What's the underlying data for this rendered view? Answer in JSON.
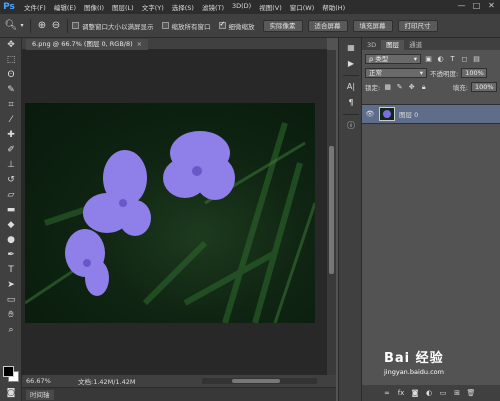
{
  "app": {
    "logo": "Ps"
  },
  "menu": [
    "文件(F)",
    "编辑(E)",
    "图像(I)",
    "图层(L)",
    "文字(Y)",
    "选择(S)",
    "滤镜(T)",
    "3D(D)",
    "视图(V)",
    "窗口(W)",
    "帮助(H)"
  ],
  "window_controls": [
    "—",
    "□",
    "✕"
  ],
  "options_bar": {
    "tool_icon": "zoom-icon",
    "checkboxes": [
      {
        "label": "调整窗口大小以满屏显示",
        "checked": false
      },
      {
        "label": "缩放所有窗口",
        "checked": false
      },
      {
        "label": "细微缩放",
        "checked": true
      }
    ],
    "buttons": [
      "实际像素",
      "适合屏幕",
      "填充屏幕",
      "打印尺寸"
    ]
  },
  "document": {
    "tab_label": "6.png @ 66.7% (图层 0, RGB/8)",
    "close": "×",
    "zoom": "66.67%",
    "status": "文档:1.42M/1.42M",
    "timeline": "时间轴"
  },
  "panel": {
    "tabs": [
      "3D",
      "图层",
      "通道"
    ],
    "active_tab": "图层",
    "filter_label": "ρ 类型",
    "blend_mode": "正常",
    "opacity_label": "不透明度:",
    "opacity_value": "100%",
    "lock_label": "锁定:",
    "fill_label": "填充:",
    "fill_value": "100%",
    "layer_name": "图层 0"
  },
  "watermark": {
    "logo": "Bai 经验",
    "url": "jingyan.baidu.com"
  },
  "colors": {
    "accent": "#4ba3ff",
    "layer_selected": "#5e6e8a",
    "petal": "#8f7fe8"
  }
}
